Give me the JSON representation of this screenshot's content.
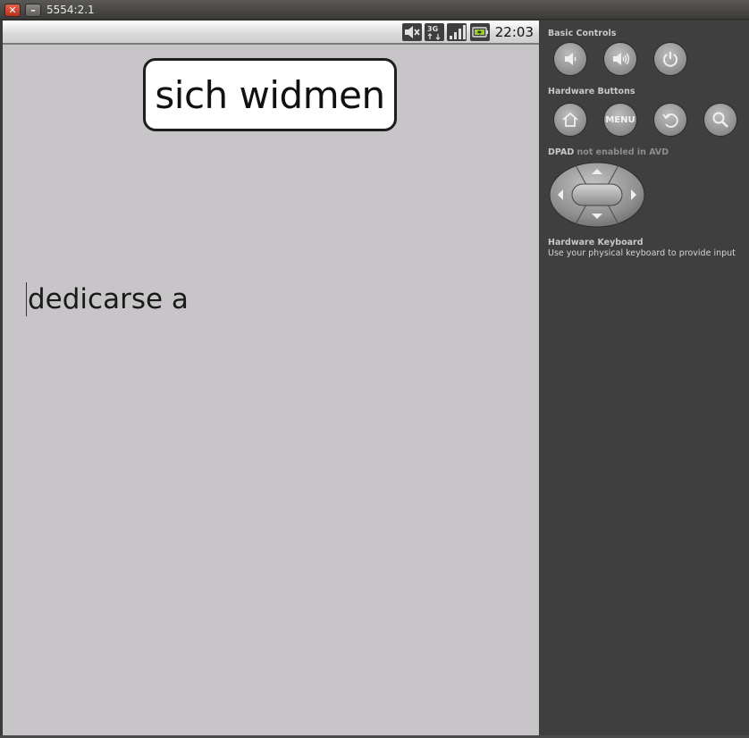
{
  "window": {
    "title": "5554:2.1",
    "close_icon": "close-icon",
    "minimize_icon": "minimize-icon"
  },
  "statusbar": {
    "time": "22:03",
    "icons": [
      "mute-icon",
      "3g-data-icon",
      "signal-icon",
      "battery-charging-icon"
    ]
  },
  "app": {
    "word": "sich widmen",
    "answer_value": "dedicarse a"
  },
  "panel": {
    "basic_controls_label": "Basic Controls",
    "basic_controls": [
      "volume-down-icon",
      "volume-up-icon",
      "power-icon"
    ],
    "hardware_buttons_label": "Hardware Buttons",
    "hardware_buttons": [
      "home-icon",
      "MENU",
      "back-icon",
      "search-icon"
    ],
    "menu_label": "MENU",
    "dpad_label": "DPAD",
    "dpad_note": "not enabled in AVD",
    "keyboard_title": "Hardware Keyboard",
    "keyboard_hint": "Use your physical keyboard to provide input"
  },
  "colors": {
    "screen_bg": "#c7c5c8",
    "panel_bg": "#3f3f3f",
    "battery_accent": "#9acd32"
  }
}
